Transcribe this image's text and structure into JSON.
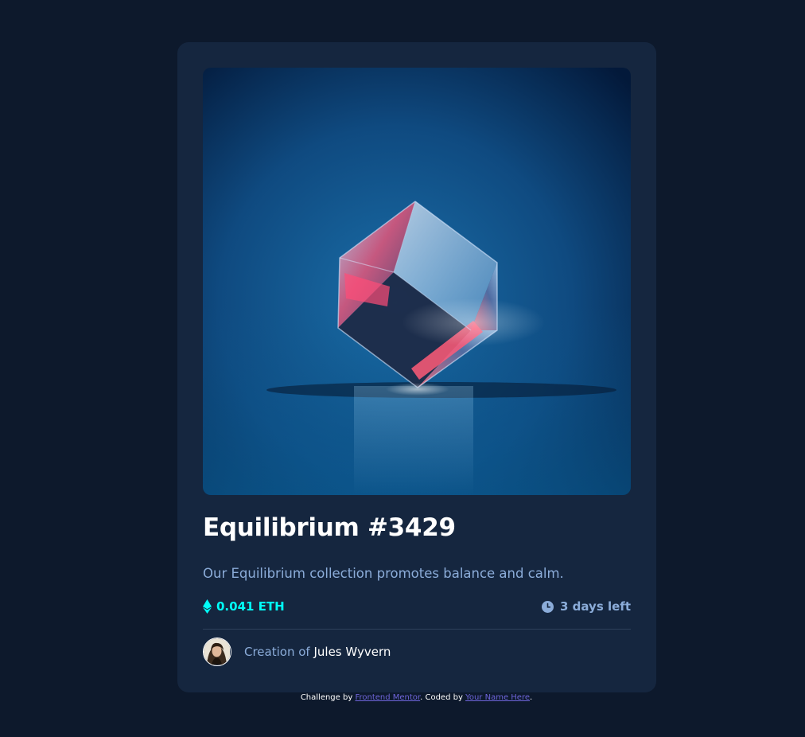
{
  "card": {
    "title": "Equilibrium #3429",
    "description": "Our Equilibrium collection promotes balance and calm.",
    "price": "0.041 ETH",
    "time_left": "3 days left",
    "creator_prefix": "Creation of",
    "creator_name": "Jules Wyvern",
    "image_icon": "equilibrium-cube-image",
    "price_icon": "ethereum-icon",
    "time_icon": "clock-icon"
  },
  "attribution": {
    "challenge_prefix": "Challenge by",
    "challenge_link": "Frontend Mentor",
    "coded_prefix": ". Coded by",
    "coder_link": "Your Name Here",
    "suffix": "."
  },
  "colors": {
    "page_bg": "#0d192c",
    "card_bg": "#15263f",
    "cyan": "#00fff8",
    "soft_blue": "#8bacd9",
    "white": "#ffffff",
    "link": "#6d64d9"
  }
}
